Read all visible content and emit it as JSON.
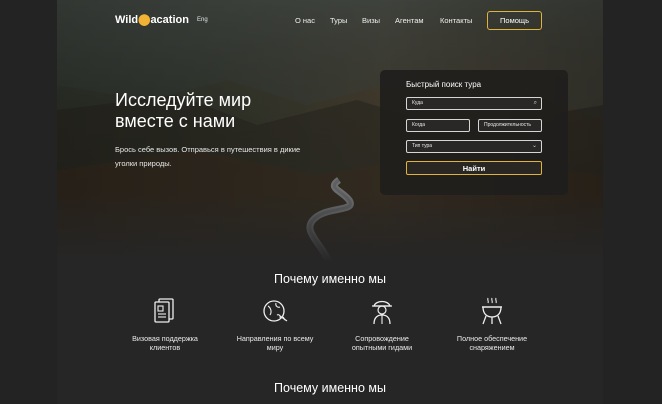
{
  "header": {
    "logo_text_left": "Wild",
    "logo_text_right": "acation",
    "lang": "Eng",
    "nav": [
      "О нас",
      "Туры",
      "Визы",
      "Агентам",
      "Контакты"
    ],
    "help_button": "Помощь"
  },
  "hero": {
    "title_line1": "Исследуйте мир",
    "title_line2": "вместе с нами",
    "subtitle_line1": "Брось себе вызов. Отправься в путешествия в дикие",
    "subtitle_line2": "уголки природы."
  },
  "search": {
    "title": "Быстрый поиск тура",
    "where_value": "Куда",
    "when_value": "Когда",
    "duration_value": "Продолжительность",
    "type_value": "Тип тура",
    "find_button": "Найти"
  },
  "features": {
    "section_title": "Почему именно мы",
    "items": [
      {
        "label_line1": "Визовая поддержка",
        "label_line2": "клиентов",
        "icon": "passport-documents-icon"
      },
      {
        "label_line1": "Направления по всему",
        "label_line2": "миру",
        "icon": "globe-plane-icon"
      },
      {
        "label_line1": "Сопровождение",
        "label_line2": "опытными гидами",
        "icon": "guide-explorer-icon"
      },
      {
        "label_line1": "Полное обеспечение",
        "label_line2": "снаряжением",
        "icon": "grill-equipment-icon"
      }
    ]
  },
  "second_section": {
    "title": "Почему именно мы"
  },
  "colors": {
    "accent": "#e0b43a",
    "background": "#262626",
    "card": "#201e1c"
  }
}
